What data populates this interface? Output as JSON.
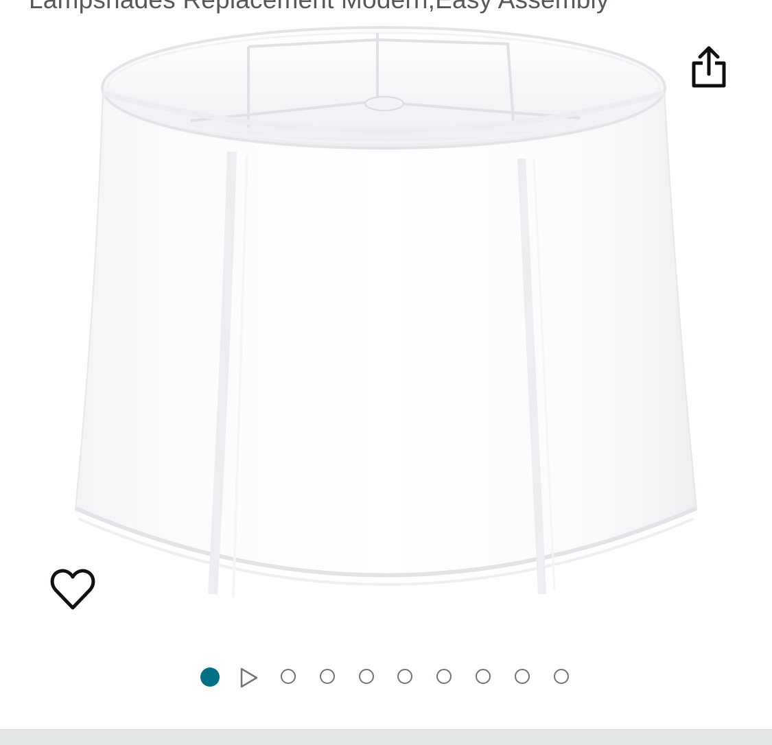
{
  "product": {
    "title": "Lampshades Replacement Modern,Easy Assembly",
    "image_alt": "White drum lampshade"
  },
  "actions": {
    "share_icon": "share-icon",
    "favorite_icon": "heart-icon"
  },
  "carousel": {
    "total_slides": 10,
    "active_index": 0,
    "video_index": 1,
    "active_color": "#007185",
    "inactive_color": "#6f7373"
  }
}
